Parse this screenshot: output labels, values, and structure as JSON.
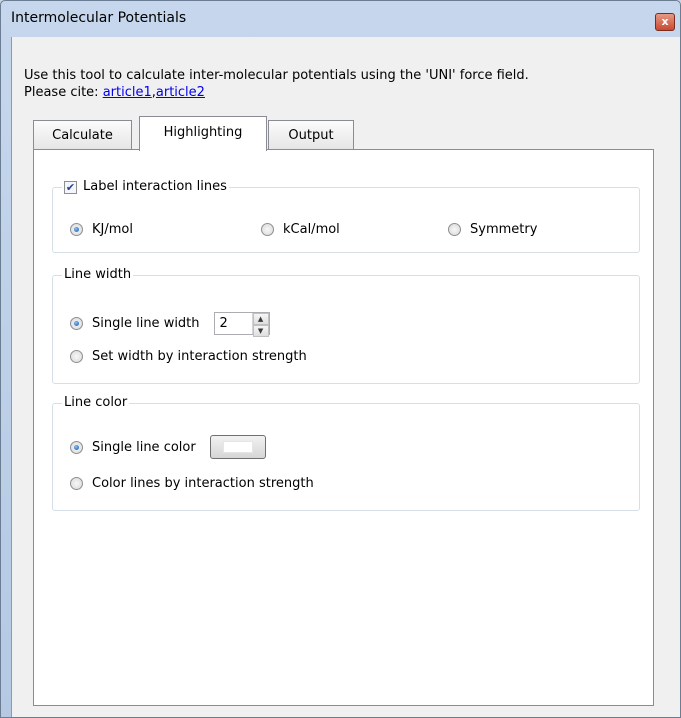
{
  "window": {
    "title": "Intermolecular Potentials",
    "close_label": "x"
  },
  "description": {
    "line1": "Use this tool to calculate inter-molecular potentials using the 'UNI' force field.",
    "cite_prefix": "Please cite: ",
    "link1": "article1",
    "separator": ",",
    "link2": "article2"
  },
  "tabs": [
    {
      "label": "Calculate",
      "selected": false
    },
    {
      "label": "Highlighting",
      "selected": true
    },
    {
      "label": "Output",
      "selected": false
    }
  ],
  "label_group": {
    "checkbox_label": "Label interaction lines",
    "checked": true,
    "options": [
      {
        "label": "KJ/mol",
        "selected": true
      },
      {
        "label": "kCal/mol",
        "selected": false
      },
      {
        "label": "Symmetry",
        "selected": false
      }
    ]
  },
  "line_width_group": {
    "title": "Line width",
    "single_label": "Single line width",
    "single_selected": true,
    "width_value": "2",
    "strength_label": "Set width by interaction strength",
    "strength_selected": false
  },
  "line_color_group": {
    "title": "Line color",
    "single_label": "Single line color",
    "single_selected": true,
    "swatch_color": "#ffffff",
    "strength_label": "Color lines by interaction strength",
    "strength_selected": false
  }
}
